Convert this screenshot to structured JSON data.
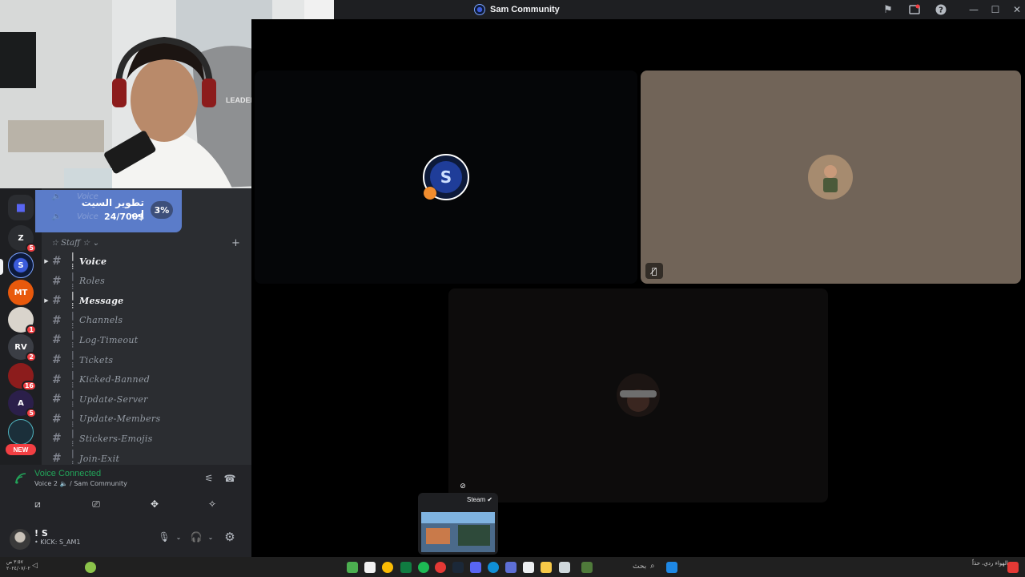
{
  "window": {
    "title": "Sam Community"
  },
  "promo": {
    "title": "تطوير السيت اب",
    "amount": "24/700$",
    "percent": "3%",
    "ghost_top": "Voice",
    "ghost_bottom": "Voice"
  },
  "category": {
    "label": "☆ Staff ☆ ⌄",
    "add_label": "+"
  },
  "channels": [
    {
      "name": "Voice",
      "active": true
    },
    {
      "name": "Roles",
      "active": false
    },
    {
      "name": "Message",
      "active": true
    },
    {
      "name": "Channels",
      "active": false
    },
    {
      "name": "Log-Timeout",
      "active": false
    },
    {
      "name": "Tickets",
      "active": false
    },
    {
      "name": "Kicked-Banned",
      "active": false
    },
    {
      "name": "Update-Server",
      "active": false
    },
    {
      "name": "Update-Members",
      "active": false
    },
    {
      "name": "Stickers-Emojis",
      "active": false
    },
    {
      "name": "Join-Exit",
      "active": false
    }
  ],
  "guilds": [
    {
      "icon": "folder-icon",
      "label": "",
      "badge": ""
    },
    {
      "icon": "server-z-icon",
      "label": "Z",
      "badge": "5"
    },
    {
      "icon": "sam-community-icon",
      "label": "S",
      "badge": ""
    },
    {
      "icon": "mt-server-icon",
      "label": "MT",
      "badge": ""
    },
    {
      "icon": "panda-server-icon",
      "label": "",
      "badge": "1"
    },
    {
      "icon": "rv-server-icon",
      "label": "RV",
      "badge": "2"
    },
    {
      "icon": "red-server-icon",
      "label": "",
      "badge": "16"
    },
    {
      "icon": "purple-server-icon",
      "label": "A",
      "badge": "5"
    },
    {
      "icon": "teal-server-icon",
      "label": "",
      "badge": ""
    }
  ],
  "new_badge": "NEW",
  "voice": {
    "status": "Voice Connected",
    "channel": "Voice 2 🔈 / Sam Community"
  },
  "user": {
    "name": "! S",
    "status": "• KICK: S_AM1"
  },
  "stream": {
    "label": "Steam ✔"
  },
  "taskbar": {
    "search": "بحث",
    "clock_time": "٣:٥٧ ص",
    "clock_date": "٢٠٢٤/٠٧/٠٢",
    "news": "الهواء ردي، حذاً"
  },
  "colors": {
    "discord_bg": "#2b2d31",
    "guild_bg": "#1e1f22",
    "panel_bg": "#232428",
    "green": "#23a55a",
    "red": "#f23f43",
    "promo": "#5b7cc9"
  }
}
